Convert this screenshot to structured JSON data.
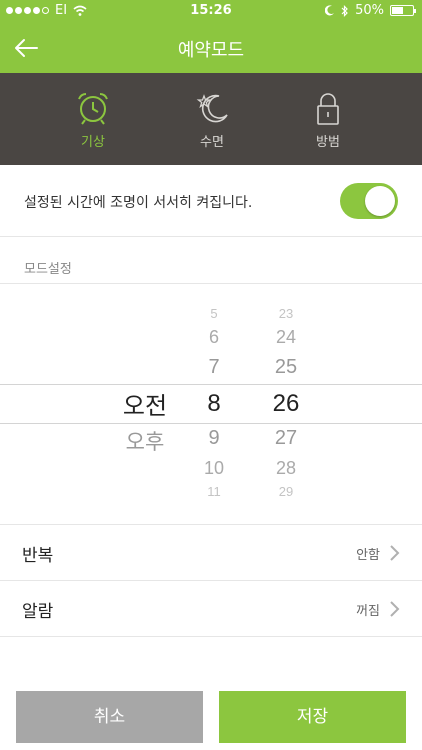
{
  "status_bar": {
    "carrier": "EI",
    "time": "15:26",
    "battery": "50%"
  },
  "nav": {
    "title": "예약모드"
  },
  "modes": [
    {
      "label": "기상",
      "icon": "alarm-clock-icon",
      "active": true
    },
    {
      "label": "수면",
      "icon": "moon-star-icon",
      "active": false
    },
    {
      "label": "방범",
      "icon": "lock-icon",
      "active": false
    }
  ],
  "notice": {
    "text": "설정된 시간에 조명이 서서히 켜집니다.",
    "toggle_on": true
  },
  "section": {
    "label": "모드설정"
  },
  "picker": {
    "ampm": [
      "오전",
      "오후"
    ],
    "hours": [
      "5",
      "6",
      "7",
      "8",
      "9",
      "10",
      "11"
    ],
    "minutes": [
      "23",
      "24",
      "25",
      "26",
      "27",
      "28",
      "29"
    ],
    "selected": {
      "ampm": "오전",
      "hour": "8",
      "minute": "26"
    }
  },
  "rows": {
    "repeat": {
      "label": "반복",
      "value": "안함"
    },
    "alarm": {
      "label": "알람",
      "value": "꺼짐"
    }
  },
  "buttons": {
    "cancel": "취소",
    "save": "저장"
  },
  "colors": {
    "accent": "#8cc63f",
    "modebar": "#4a4643",
    "cancel": "#a7a7a7"
  }
}
